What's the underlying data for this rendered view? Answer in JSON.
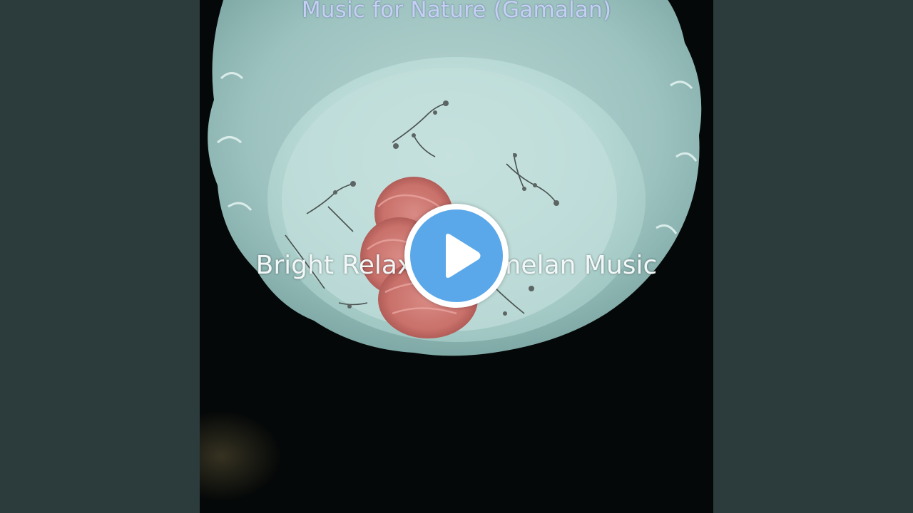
{
  "video": {
    "title": "Music for Nature (Gamalan)",
    "subtitle": "Bright Relaxing Gamelan Music",
    "play_icon": "play-icon"
  },
  "colors": {
    "side_bar": "#2c3b3b",
    "play_accent": "#5aa8ea",
    "title_text": "#c7d0f4"
  }
}
